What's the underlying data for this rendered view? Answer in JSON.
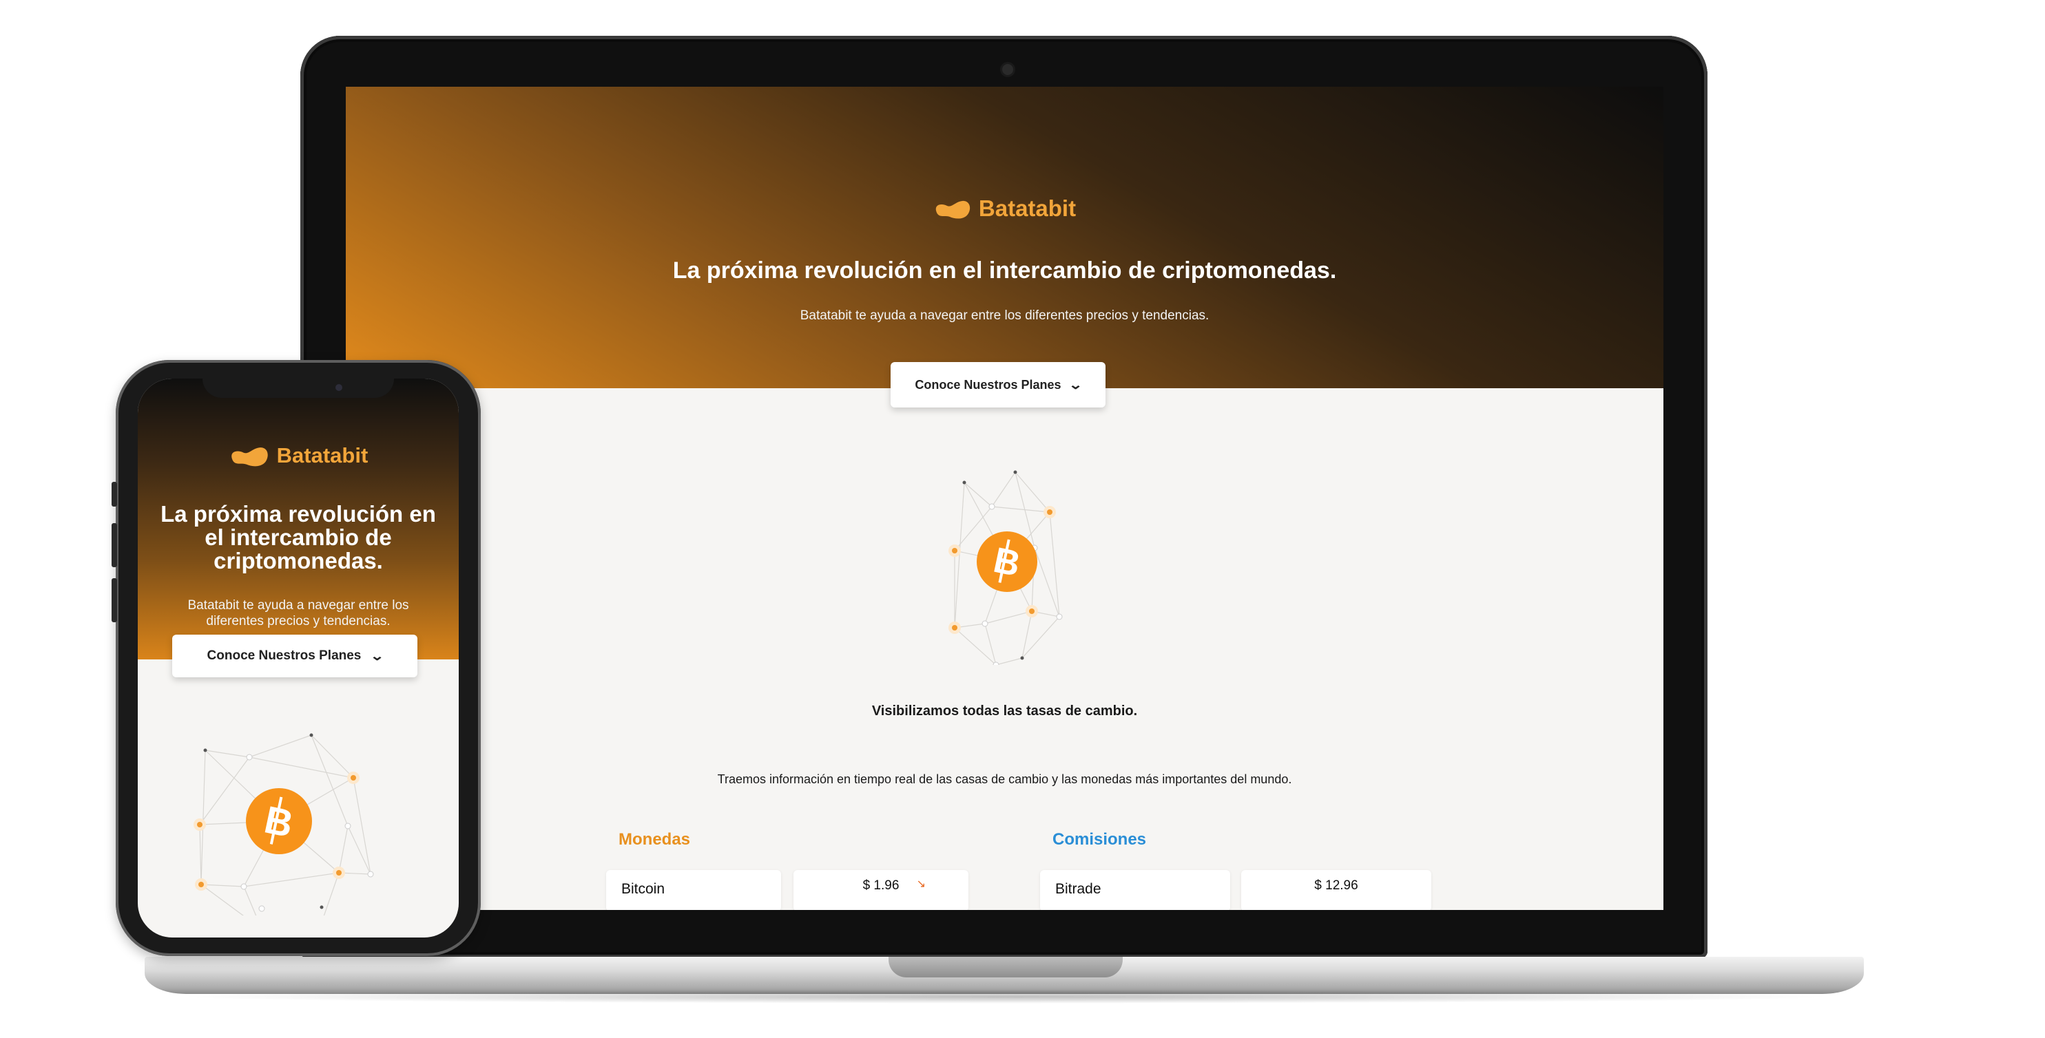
{
  "brand": {
    "name": "Batatabit",
    "accent": "#f2a53a",
    "gradient_dark": "#0d0d0d",
    "gradient_orange": "#e38b1c"
  },
  "hero": {
    "title": "La próxima revolución en el intercambio de criptomonedas.",
    "subtitle": "Batatabit te ayuda a navegar entre los diferentes precios y tendencias.",
    "plans_button": "Conoce Nuestros Planes"
  },
  "main": {
    "tagline": "Visibilizamos todas las tasas de cambio.",
    "description": "Traemos información en tiempo real de las casas de cambio y las monedas más importantes del mundo."
  },
  "monedas": {
    "title": "Monedas",
    "color": "#e8901e",
    "rows": [
      {
        "name": "Bitcoin",
        "value": "$ 1.96",
        "trend": "down"
      }
    ]
  },
  "comisiones": {
    "title": "Comisiones",
    "color": "#2a8ed6",
    "rows": [
      {
        "name": "Bitrade",
        "value": "$ 12.96"
      }
    ]
  },
  "icons": {
    "bitcoin": "bitcoin-icon",
    "chevron": "chevron-down-icon",
    "logo": "batata-logo-icon",
    "trend": "trend-down-icon"
  }
}
